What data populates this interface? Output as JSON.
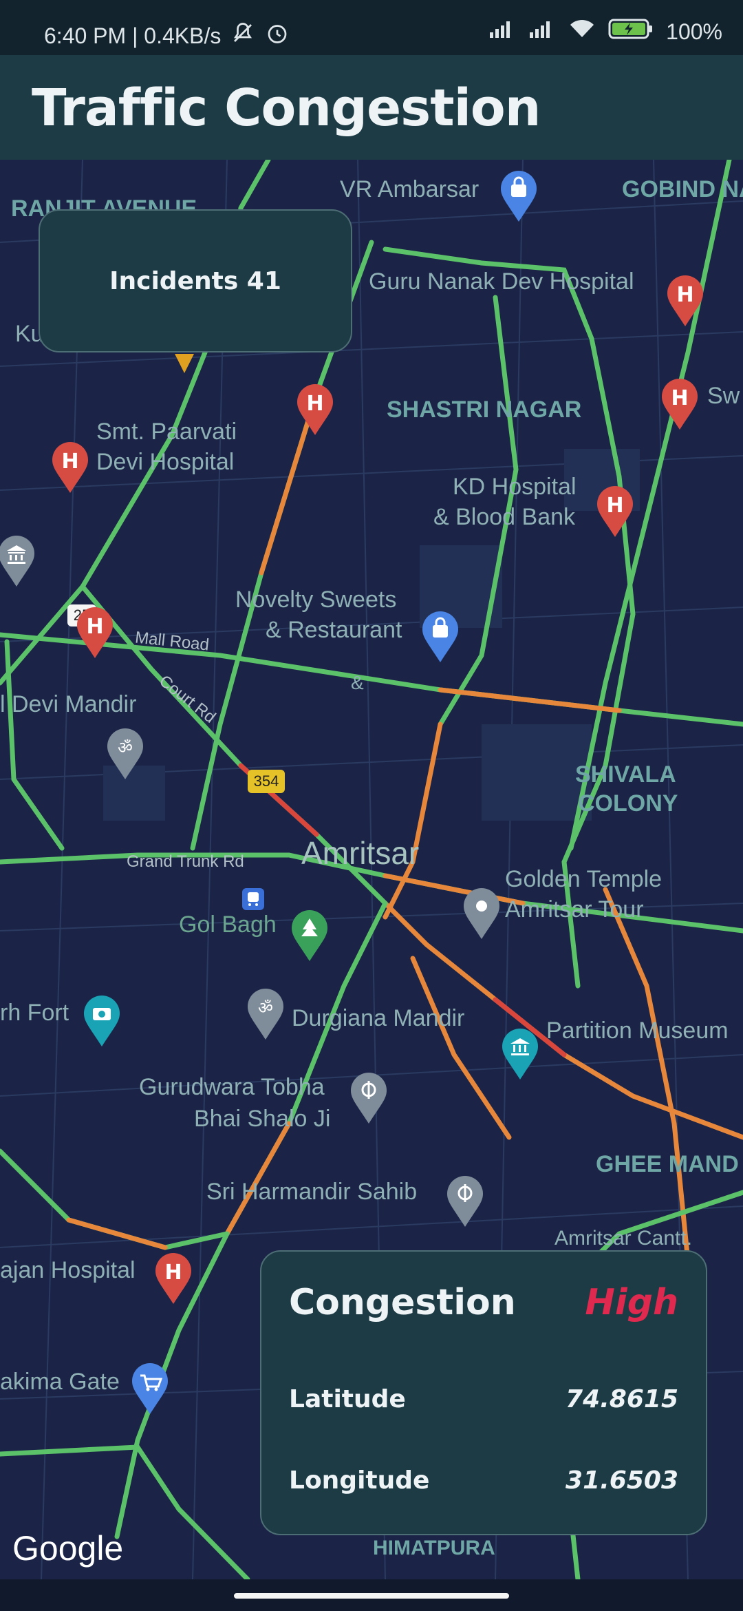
{
  "status_bar": {
    "time_and_speed": "6:40 PM | 0.4KB/s",
    "battery": "100%"
  },
  "app_bar": {
    "title": "Traffic Congestion"
  },
  "incidents": {
    "text": "Incidents 41"
  },
  "congestion_card": {
    "congestion_label": "Congestion",
    "congestion_value": "High",
    "latitude_label": "Latitude",
    "latitude_value": "74.8615",
    "longitude_label": "Longitude",
    "longitude_value": "31.6503"
  },
  "map": {
    "labels": {
      "ranjit_avenue": "RANJIT AVENUE",
      "vr_ambarsar": "VR Ambarsar",
      "gobind_nagar": "GOBIND NA",
      "guru_nanak_hospital": "Guru Nanak Dev Hospital",
      "ku": "Ku",
      "shastri_nagar": "SHASTRI NAGAR",
      "sw": "Sw",
      "paarvati_hospital_1": "Smt. Paarvati",
      "paarvati_hospital_2": "Devi Hospital",
      "kd_hospital_1": "KD Hospital",
      "kd_hospital_2": "& Blood Bank",
      "novelty_1": "Novelty Sweets",
      "novelty_2": "& Restaurant",
      "mall_road": "Mall Road",
      "amp": "&",
      "devi_mandir": "l Devi Mandir",
      "court_rd": "Court Rd",
      "shivala_1": "SHIVALA",
      "shivala_2": "COLONY",
      "grand_trunk_rd": "Grand Trunk Rd",
      "amritsar": "Amritsar",
      "golden_temple_1": "Golden Temple",
      "golden_temple_2": "Amritsar Tour",
      "gol_bagh": "Gol Bagh",
      "rh_fort": "rh Fort",
      "durgiana": "Durgiana Mandir",
      "partition_museum": "Partition Museum",
      "gurudwara_1": "Gurudwara Tobha",
      "gurudwara_2": "Bhai Shalo Ji",
      "ghee_mandi": "GHEE MAND",
      "sri_harmandir": "Sri Harmandir Sahib",
      "amritsar_cantt": "Amritsar Cantt.",
      "ajan_hospital": "ajan Hospital",
      "akima_gate": "akima Gate",
      "himatpura": "HIMATPURA",
      "route_25": "25",
      "route_354": "354"
    },
    "attribution": "Google"
  },
  "colors": {
    "app_bar": "#1d3b45",
    "status_bar": "#12232d",
    "map_background": "#1b2447",
    "congestion_high": "#e0294e",
    "traffic_green": "#5cc26a",
    "traffic_orange": "#e7873b",
    "traffic_red": "#d8463c",
    "hospital_pin": "#d64c43"
  },
  "icons": [
    "wifi-icon",
    "signal-icon",
    "battery-icon",
    "alarm-icon",
    "mute-icon",
    "hospital-pin-icon",
    "shopping-pin-icon",
    "temple-pin-icon",
    "museum-pin-icon",
    "camera-pin-icon",
    "park-pin-icon",
    "transit-icon"
  ]
}
